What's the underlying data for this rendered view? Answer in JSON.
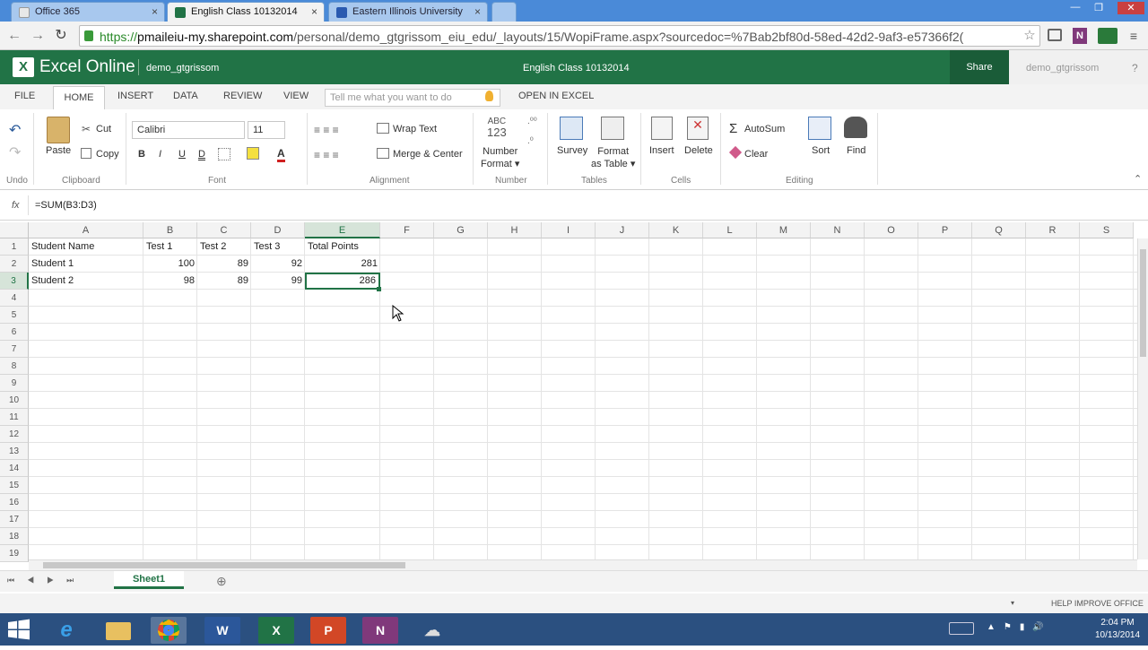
{
  "browser": {
    "tabs": [
      {
        "label": "Office 365",
        "close": "×"
      },
      {
        "label": "English Class 10132014",
        "close": "×"
      },
      {
        "label": "Eastern Illinois University",
        "close": "×"
      }
    ],
    "url": "https://pmaileiu-my.sharepoint.com/personal/demo_gtgrissom_eiu_edu/_layouts/15/WopiFrame.aspx?sourcedoc=%7Bab2bf80d-58ed-42d2-9af3-e57366f2(",
    "url_scheme": "https://",
    "url_host": "pmaileiu-my.sharepoint.com",
    "url_path": "/personal/demo_gtgrissom_eiu_edu/_layouts/15/WopiFrame.aspx?sourcedoc=%7Bab2bf80d-58ed-42d2-9af3-e57366f2(",
    "window_buttons": [
      "—",
      "❐",
      "✕"
    ]
  },
  "excel": {
    "app_name": "Excel Online",
    "user": "demo_gtgrissom",
    "doc_title": "English Class 10132014",
    "share_label": "Share",
    "user_right": "demo_gtgrissom",
    "help": "?"
  },
  "ribbon_tabs": [
    "FILE",
    "HOME",
    "INSERT",
    "DATA",
    "REVIEW",
    "VIEW"
  ],
  "tell_me_placeholder": "Tell me what you want to do",
  "open_in_excel": "OPEN IN EXCEL",
  "ribbon": {
    "undo_group": "Undo",
    "clipboard": {
      "paste": "Paste",
      "cut": "Cut",
      "copy": "Copy",
      "group": "Clipboard"
    },
    "font": {
      "name": "Calibri",
      "size": "11",
      "bold": "B",
      "italic": "I",
      "underline": "U",
      "dunderline": "D",
      "color_a": "A",
      "group": "Font"
    },
    "alignment": {
      "wrap": "Wrap Text",
      "merge": "Merge & Center",
      "group": "Alignment"
    },
    "number": {
      "format_line1": "Number",
      "format_line2": "Format",
      "abc": "ABC",
      "n123": "123",
      "group": "Number"
    },
    "tables": {
      "survey": "Survey",
      "fmt_line1": "Format",
      "fmt_line2": "as Table",
      "group": "Tables"
    },
    "cells": {
      "insert": "Insert",
      "delete": "Delete",
      "group": "Cells"
    },
    "editing": {
      "autosum": "AutoSum",
      "clear": "Clear",
      "sort": "Sort",
      "find": "Find",
      "group": "Editing"
    }
  },
  "formula_bar": {
    "fx": "fx",
    "formula": "=SUM(B3:D3)"
  },
  "columns": [
    "A",
    "B",
    "C",
    "D",
    "E",
    "F",
    "G",
    "H",
    "I",
    "J",
    "K",
    "L",
    "M",
    "N",
    "O",
    "P",
    "Q",
    "R",
    "S"
  ],
  "rows": [
    "1",
    "2",
    "3",
    "4",
    "5",
    "6",
    "7",
    "8",
    "9",
    "10",
    "11",
    "12",
    "13",
    "14",
    "15",
    "16",
    "17",
    "18",
    "19"
  ],
  "cells": {
    "r1": {
      "a": "Student Name",
      "b": "Test 1",
      "c": "Test 2",
      "d": "Test 3",
      "e": "Total Points"
    },
    "r2": {
      "a": "Student 1",
      "b": "100",
      "c": "89",
      "d": "92",
      "e": "281"
    },
    "r3": {
      "a": "Student 2",
      "b": "98",
      "c": "89",
      "d": "99",
      "e": "286"
    }
  },
  "selected_cell": "E3",
  "sheet_tab": "Sheet1",
  "add_sheet": "⊕",
  "status": {
    "help_improve": "HELP IMPROVE OFFICE"
  },
  "taskbar": {
    "time": "2:04 PM",
    "date": "10/13/2014"
  },
  "colors": {
    "excel_green": "#217346",
    "browser_blue": "#4a8ad8",
    "taskbar": "#2b5080"
  }
}
